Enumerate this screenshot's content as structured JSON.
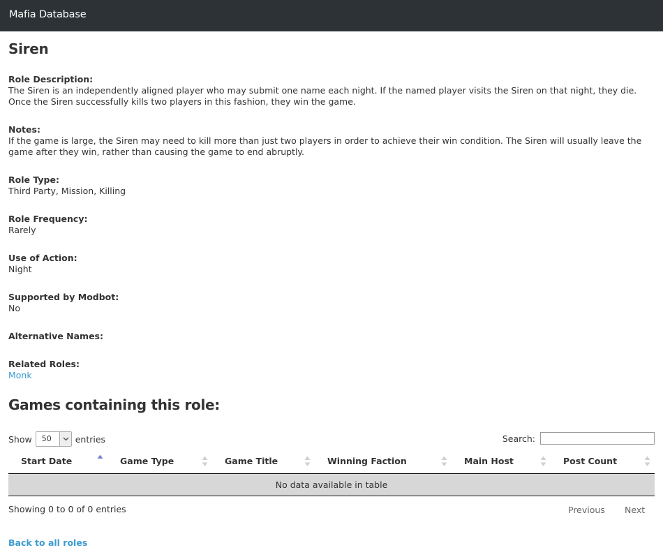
{
  "navbar": {
    "brand": "Mafia Database"
  },
  "role": {
    "title": "Siren",
    "fields": [
      {
        "label": "Role Description:",
        "value": "The Siren is an independently aligned player who may submit one name each night. If the named player visits the Siren on that night, they die. Once the Siren successfully kills two players in this fashion, they win the game."
      },
      {
        "label": "Notes:",
        "value": "If the game is large, the Siren may need to kill more than just two players in order to achieve their win condition. The Siren will usually leave the game after they win, rather than causing the game to end abruptly."
      },
      {
        "label": "Role Type:",
        "value": "Third Party, Mission, Killing"
      },
      {
        "label": "Role Frequency:",
        "value": "Rarely"
      },
      {
        "label": "Use of Action:",
        "value": "Night"
      },
      {
        "label": "Supported by Modbot:",
        "value": "No"
      },
      {
        "label": "Alternative Names:",
        "value": ""
      },
      {
        "label": "Related Roles:",
        "value": "Monk"
      }
    ]
  },
  "games": {
    "title": "Games containing this role:",
    "length": {
      "show_label": "Show",
      "selected": "50",
      "entries_label": "entries"
    },
    "search": {
      "label": "Search:",
      "value": "",
      "placeholder": ""
    },
    "columns": [
      "Start Date",
      "Game Type",
      "Game Title",
      "Winning Faction",
      "Main Host",
      "Post Count"
    ],
    "sorted_column": "Start Date",
    "empty_message": "No data available in table",
    "info": "Showing 0 to 0 of 0 entries",
    "pagination": {
      "previous": "Previous",
      "next": "Next"
    }
  },
  "footer": {
    "back_link": "Back to all roles"
  },
  "colors": {
    "navbar": "#2d3236",
    "link": "#3d9bd1",
    "empty_row": "#d7d7d7",
    "sort_active": "#7b7fd1",
    "sort_inactive": "#d0d0d0"
  },
  "icons": {
    "sort": "sort-arrows-icon",
    "select": "chevron-down-icon"
  }
}
